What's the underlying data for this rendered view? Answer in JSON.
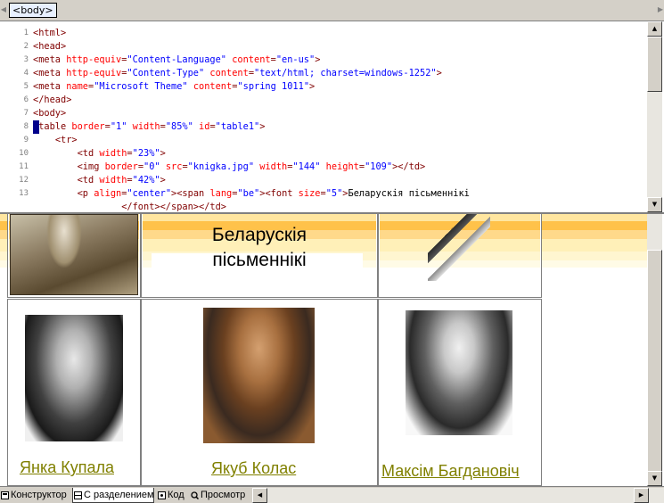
{
  "tagbar": {
    "tag": "<body>"
  },
  "code": {
    "lines": [
      {
        "n": "1",
        "parts": [
          [
            "tag",
            "<html>"
          ]
        ]
      },
      {
        "n": "2",
        "parts": [
          [
            "tag",
            "<head>"
          ]
        ]
      },
      {
        "n": "3",
        "parts": [
          [
            "tag",
            "<meta "
          ],
          [
            "attr",
            "http-equiv"
          ],
          [
            "tag",
            "="
          ],
          [
            "val",
            "\"Content-Language\""
          ],
          [
            "tag",
            " "
          ],
          [
            "attr",
            "content"
          ],
          [
            "tag",
            "="
          ],
          [
            "val",
            "\"en-us\""
          ],
          [
            "tag",
            ">"
          ]
        ]
      },
      {
        "n": "4",
        "parts": [
          [
            "tag",
            "<meta "
          ],
          [
            "attr",
            "http-equiv"
          ],
          [
            "tag",
            "="
          ],
          [
            "val",
            "\"Content-Type\""
          ],
          [
            "tag",
            " "
          ],
          [
            "attr",
            "content"
          ],
          [
            "tag",
            "="
          ],
          [
            "val",
            "\"text/html; charset=windows-1252\""
          ],
          [
            "tag",
            ">"
          ]
        ]
      },
      {
        "n": "5",
        "parts": [
          [
            "tag",
            "<meta "
          ],
          [
            "attr",
            "name"
          ],
          [
            "tag",
            "="
          ],
          [
            "val",
            "\"Microsoft Theme\""
          ],
          [
            "tag",
            " "
          ],
          [
            "attr",
            "content"
          ],
          [
            "tag",
            "="
          ],
          [
            "val",
            "\"spring 1011\""
          ],
          [
            "tag",
            ">"
          ]
        ]
      },
      {
        "n": "6",
        "parts": [
          [
            "tag",
            "</head>"
          ]
        ]
      },
      {
        "n": "7",
        "parts": [
          [
            "tag",
            "<body>"
          ]
        ]
      },
      {
        "n": "8",
        "parts": [
          [
            "tag",
            "<table "
          ],
          [
            "attr",
            "border"
          ],
          [
            "tag",
            "="
          ],
          [
            "val",
            "\"1\""
          ],
          [
            "tag",
            " "
          ],
          [
            "attr",
            "width"
          ],
          [
            "tag",
            "="
          ],
          [
            "val",
            "\"85%\""
          ],
          [
            "tag",
            " "
          ],
          [
            "attr",
            "id"
          ],
          [
            "tag",
            "="
          ],
          [
            "val",
            "\"table1\""
          ],
          [
            "tag",
            ">"
          ]
        ]
      },
      {
        "n": "9",
        "parts": [
          [
            "text",
            "    "
          ],
          [
            "tag",
            "<tr>"
          ]
        ]
      },
      {
        "n": "10",
        "parts": [
          [
            "text",
            "        "
          ],
          [
            "tag",
            "<td "
          ],
          [
            "attr",
            "width"
          ],
          [
            "tag",
            "="
          ],
          [
            "val",
            "\"23%\""
          ],
          [
            "tag",
            ">"
          ]
        ]
      },
      {
        "n": "11",
        "parts": [
          [
            "text",
            "        "
          ],
          [
            "tag",
            "<img "
          ],
          [
            "attr",
            "border"
          ],
          [
            "tag",
            "="
          ],
          [
            "val",
            "\"0\""
          ],
          [
            "tag",
            " "
          ],
          [
            "attr",
            "src"
          ],
          [
            "tag",
            "="
          ],
          [
            "val",
            "\"knigka.jpg\""
          ],
          [
            "tag",
            " "
          ],
          [
            "attr",
            "width"
          ],
          [
            "tag",
            "="
          ],
          [
            "val",
            "\"144\""
          ],
          [
            "tag",
            " "
          ],
          [
            "attr",
            "height"
          ],
          [
            "tag",
            "="
          ],
          [
            "val",
            "\"109\""
          ],
          [
            "tag",
            "></td>"
          ]
        ]
      },
      {
        "n": "12",
        "parts": [
          [
            "text",
            "        "
          ],
          [
            "tag",
            "<td "
          ],
          [
            "attr",
            "width"
          ],
          [
            "tag",
            "="
          ],
          [
            "val",
            "\"42%\""
          ],
          [
            "tag",
            ">"
          ]
        ]
      },
      {
        "n": "13",
        "parts": [
          [
            "text",
            "        "
          ],
          [
            "tag",
            "<p "
          ],
          [
            "attr",
            "align"
          ],
          [
            "tag",
            "="
          ],
          [
            "val",
            "\"center\""
          ],
          [
            "tag",
            "><span "
          ],
          [
            "attr",
            "lang"
          ],
          [
            "tag",
            "="
          ],
          [
            "val",
            "\"be\""
          ],
          [
            "tag",
            "><font "
          ],
          [
            "attr",
            "size"
          ],
          [
            "tag",
            "="
          ],
          [
            "val",
            "\"5\""
          ],
          [
            "tag",
            ">"
          ],
          [
            "text",
            "Беларускія пісьменнікі"
          ]
        ]
      },
      {
        "n": "",
        "parts": [
          [
            "text",
            "                "
          ],
          [
            "tag",
            "</font></span></td>"
          ]
        ]
      }
    ]
  },
  "design": {
    "header_line1": "Беларускія",
    "header_line2": "пісьменнікі",
    "writers": [
      {
        "name": "Янка Купала"
      },
      {
        "name": "Якуб Колас"
      },
      {
        "name": "Максім Багдановіч"
      }
    ]
  },
  "view_tabs": [
    {
      "label": "Конструктор",
      "icon": "design-view-icon"
    },
    {
      "label": "С разделением",
      "icon": "split-view-icon"
    },
    {
      "label": "Код",
      "icon": "code-view-icon"
    },
    {
      "label": "Просмотр",
      "icon": "preview-icon"
    }
  ],
  "colors": {
    "tag": "#800000",
    "attr": "#ff0000",
    "value": "#0000ff",
    "link": "#808000",
    "band_orange": "#ffd27a",
    "band_yellow": "#fff2b0"
  }
}
